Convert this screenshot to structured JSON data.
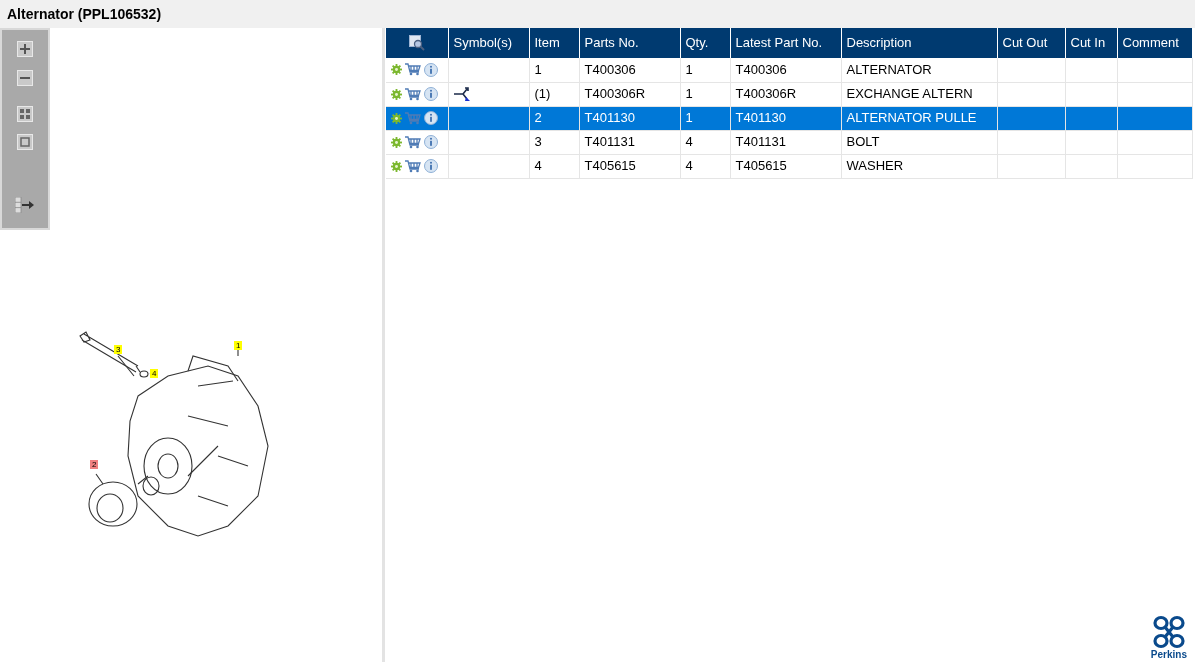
{
  "window": {
    "title": "Alternator (PPL106532)"
  },
  "diagram": {
    "callouts": [
      {
        "label": "3",
        "color": "#ffff00"
      },
      {
        "label": "4",
        "color": "#ffff00"
      },
      {
        "label": "1",
        "color": "#ffff00"
      },
      {
        "label": "2",
        "color": "#f08080"
      }
    ]
  },
  "table": {
    "columns": [
      "Symbol(s)",
      "Item",
      "Parts No.",
      "Qty.",
      "Latest Part No.",
      "Description",
      "Cut Out",
      "Cut In",
      "Comment"
    ],
    "rows": [
      {
        "selected": false,
        "exchange_symbol": false,
        "cells": [
          "",
          "1",
          "T400306",
          "1",
          "T400306",
          "ALTERNATOR",
          "",
          "",
          ""
        ]
      },
      {
        "selected": false,
        "exchange_symbol": true,
        "cells": [
          "",
          "(1)",
          "T400306R",
          "1",
          "T400306R",
          "EXCHANGE ALTERN",
          "",
          "",
          ""
        ]
      },
      {
        "selected": true,
        "exchange_symbol": false,
        "cells": [
          "",
          "2",
          "T401130",
          "1",
          "T401130",
          "ALTERNATOR PULLE",
          "",
          "",
          ""
        ]
      },
      {
        "selected": false,
        "exchange_symbol": false,
        "cells": [
          "",
          "3",
          "T401131",
          "4",
          "T401131",
          "BOLT",
          "",
          "",
          ""
        ]
      },
      {
        "selected": false,
        "exchange_symbol": false,
        "cells": [
          "",
          "4",
          "T405615",
          "4",
          "T405615",
          "WASHER",
          "",
          "",
          ""
        ]
      }
    ]
  },
  "logo": {
    "text": "Perkins"
  }
}
